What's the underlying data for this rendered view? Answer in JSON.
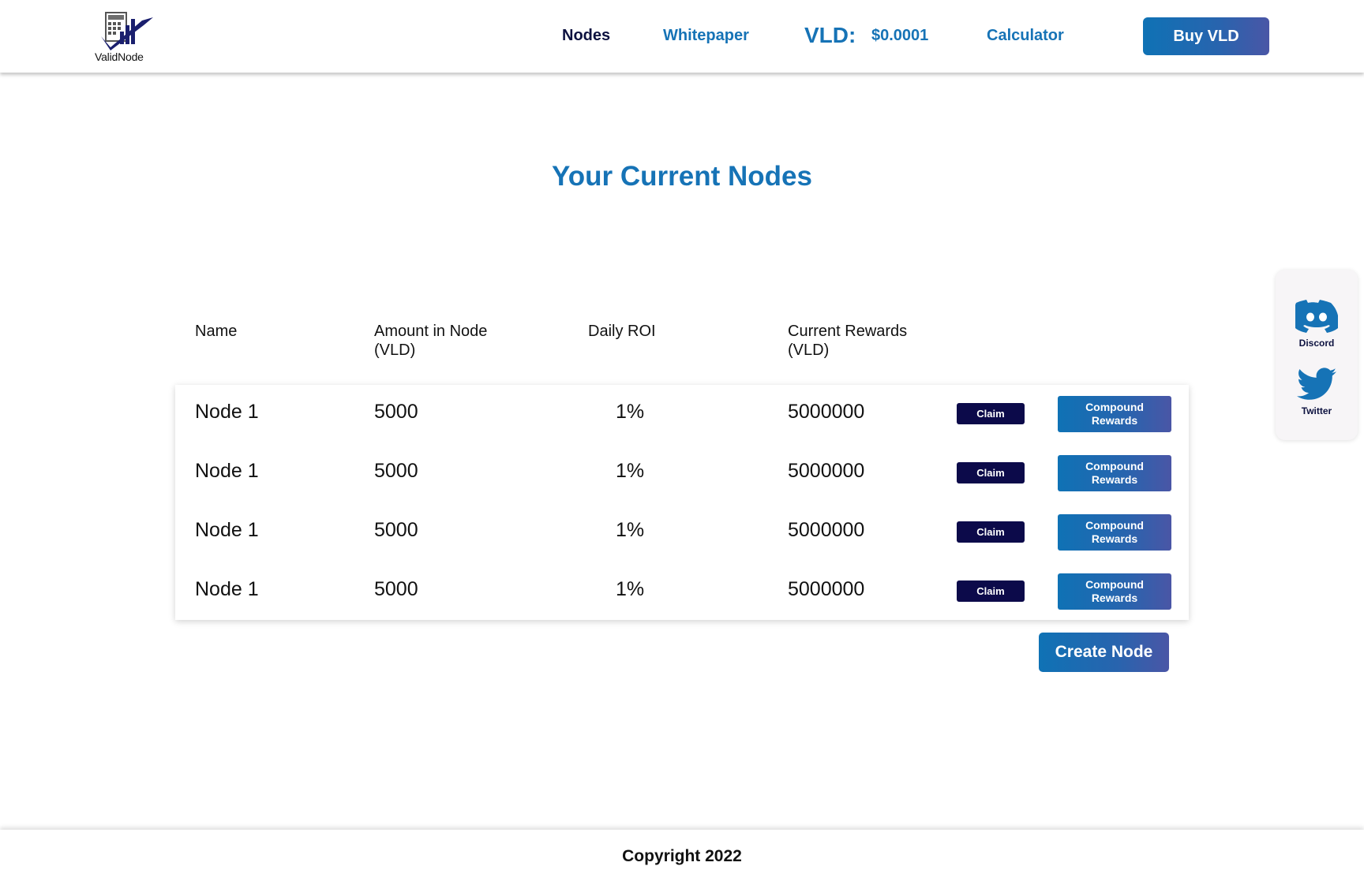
{
  "brand": {
    "name": "ValidNode"
  },
  "nav": {
    "nodes": "Nodes",
    "whitepaper": "Whitepaper",
    "vld_label": "VLD:",
    "vld_price": "$0.0001",
    "calculator": "Calculator",
    "buy": "Buy VLD"
  },
  "page": {
    "title": "Your Current Nodes"
  },
  "table": {
    "headers": {
      "name": "Name",
      "amount_line1": "Amount in Node",
      "amount_line2": "(VLD)",
      "roi": "Daily ROI",
      "rewards_line1": "Current Rewards",
      "rewards_line2": "(VLD)"
    },
    "rows": [
      {
        "name": "Node 1",
        "amount": "5000",
        "roi": "1%",
        "rewards": "5000000",
        "claim": "Claim",
        "compound": "Compound Rewards"
      },
      {
        "name": "Node 1",
        "amount": "5000",
        "roi": "1%",
        "rewards": "5000000",
        "claim": "Claim",
        "compound": "Compound Rewards"
      },
      {
        "name": "Node 1",
        "amount": "5000",
        "roi": "1%",
        "rewards": "5000000",
        "claim": "Claim",
        "compound": "Compound Rewards"
      },
      {
        "name": "Node 1",
        "amount": "5000",
        "roi": "1%",
        "rewards": "5000000",
        "claim": "Claim",
        "compound": "Compound Rewards"
      }
    ]
  },
  "create_node": "Create Node",
  "social": {
    "discord": "Discord",
    "twitter": "Twitter"
  },
  "footer": {
    "copyright": "Copyright 2022"
  },
  "colors": {
    "accent": "#1673b6",
    "dark": "#0c0a4a",
    "gradient_end": "#4a56a6"
  }
}
